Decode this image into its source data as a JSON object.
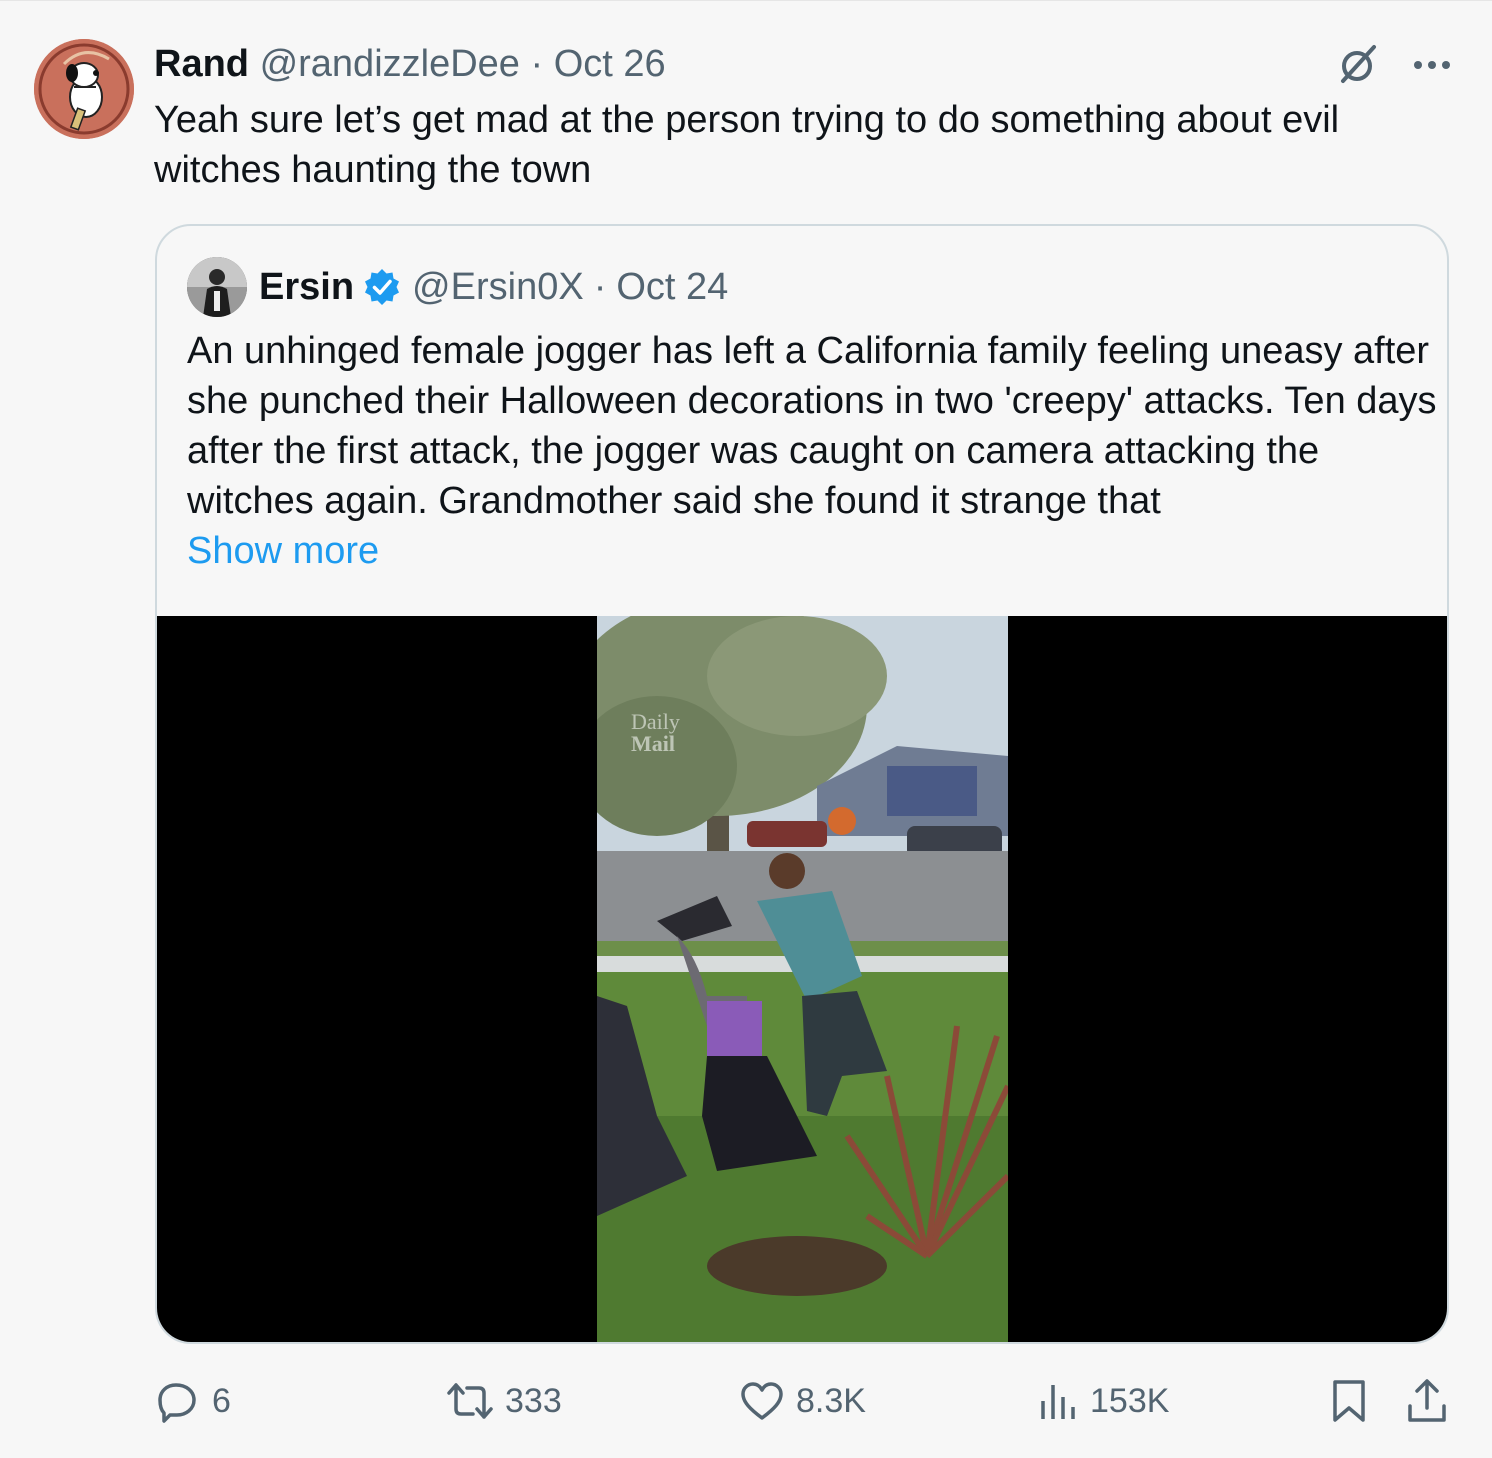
{
  "author": {
    "name": "Rand",
    "handle": "@randizzleDee",
    "separator": "·",
    "date": "Oct 26",
    "avatar_icon": "snoopy-avatar"
  },
  "tweet_text": "Yeah sure let’s get mad at the person trying to do something about evil witches haunting the town",
  "quoted": {
    "name": "Ersin",
    "verified": true,
    "handle": "@Ersin0X",
    "separator": "·",
    "date": "Oct 24",
    "text": "An unhinged female jogger has left a California family feeling uneasy after she punched their Halloween decorations in two 'creepy' attacks. Ten days after the first attack, the jogger was caught on camera attacking the witches again. Grandmother said she found it strange that",
    "show_more": "Show more",
    "media": {
      "type": "video",
      "watermark_line1": "Daily",
      "watermark_line2": "Mail"
    }
  },
  "actions": {
    "replies": "6",
    "reposts": "333",
    "likes": "8.3K",
    "views": "153K"
  },
  "colors": {
    "link": "#1d9bf0",
    "muted": "#536471",
    "background": "#f7f7f7",
    "border": "#cfd9de"
  }
}
